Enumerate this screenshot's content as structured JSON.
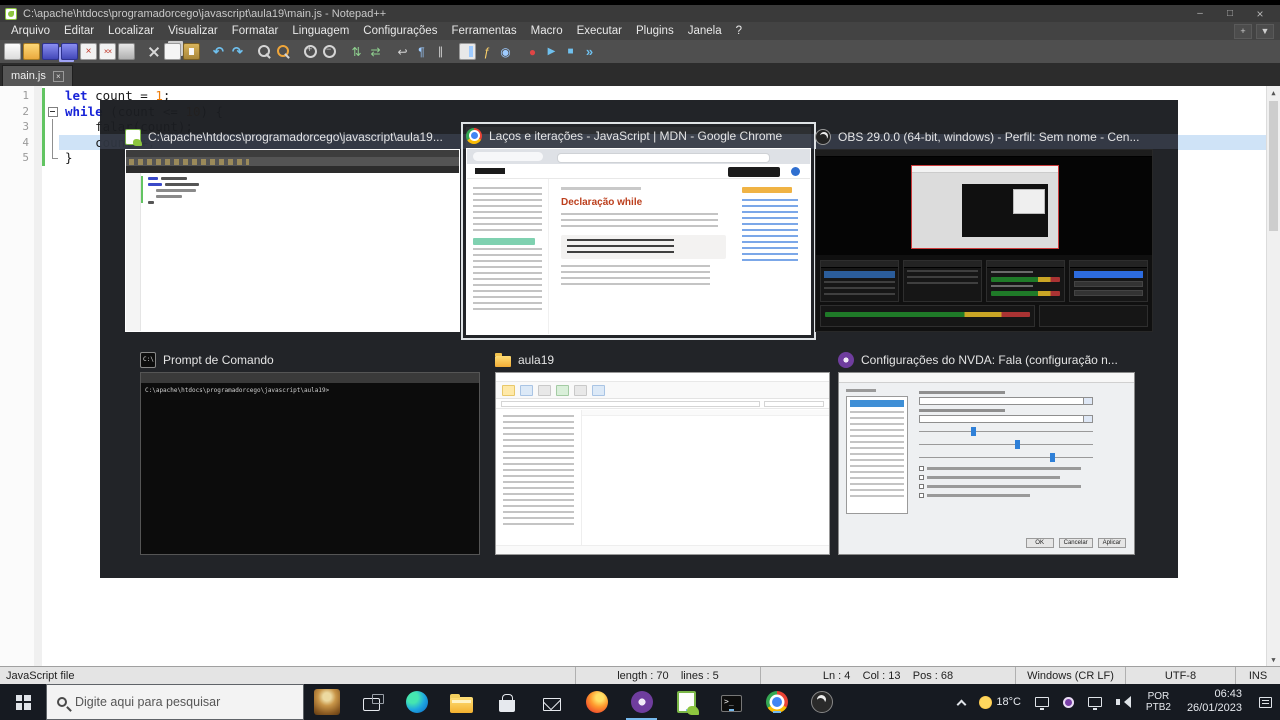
{
  "window": {
    "title": "C:\\apache\\htdocs\\programadorcego\\javascript\\aula19\\main.js - Notepad++"
  },
  "menu": {
    "items": [
      "Arquivo",
      "Editar",
      "Localizar",
      "Visualizar",
      "Formatar",
      "Linguagem",
      "Configurações",
      "Ferramentas",
      "Macro",
      "Executar",
      "Plugins",
      "Janela",
      "?"
    ],
    "plus_button": "+",
    "nav_button": "▼"
  },
  "toolbar": {
    "icons": [
      "new-file",
      "open-folder",
      "save",
      "save-all",
      "close-doc",
      "close-all",
      "print",
      "cut",
      "copy",
      "paste",
      "undo",
      "redo",
      "find",
      "replace",
      "zoom-in",
      "zoom-out",
      "sync-v",
      "sync-h",
      "word-wrap",
      "show-symbols",
      "indent-guide",
      "doc-map",
      "function-list",
      "monitor",
      "record-macro",
      "play-macro",
      "stop-macro",
      "multi-play"
    ]
  },
  "tabs": {
    "active": "main.js"
  },
  "editor": {
    "lines": {
      "l1": {
        "n": "1",
        "kw": "let",
        "mid": " count = ",
        "num": "1",
        "end": ";"
      },
      "l2": {
        "n": "2",
        "kw": "while",
        "mid": " (count <= ",
        "num": "10",
        "end": ") {"
      },
      "l3": {
        "n": "3",
        "code": "    falar(count);"
      },
      "l4": {
        "n": "4",
        "code": "    count++;"
      },
      "l5": {
        "n": "5",
        "code": "}"
      }
    }
  },
  "statusbar": {
    "doctype": "JavaScript file",
    "length": "length : 70    lines : 5",
    "position": "Ln : 4    Col : 13    Pos : 68",
    "eol": "Windows (CR LF)",
    "encoding": "UTF-8",
    "mode": "INS"
  },
  "alttab": {
    "windows": [
      {
        "title": "C:\\apache\\htdocs\\programadorcego\\javascript\\aula19..."
      },
      {
        "title": "Laços e iterações - JavaScript | MDN - Google Chrome"
      },
      {
        "title": "OBS 29.0.0 (64-bit, windows) - Perfil: Sem nome - Cen..."
      },
      {
        "title": "Prompt de Comando"
      },
      {
        "title": "aula19"
      },
      {
        "title": "Configurações do NVDA: Fala (configuração n..."
      }
    ],
    "mdn_heading": "Declaração while",
    "cmd_prompt": "C:\\apache\\htdocs\\programadorcego\\javascript\\aula19>",
    "nvda_ok": "OK",
    "nvda_cancel": "Cancelar",
    "nvda_apply": "Aplicar"
  },
  "taskbar": {
    "search_placeholder": "Digite aqui para pesquisar",
    "icons": [
      {
        "name": "pinned-app",
        "open": false
      },
      {
        "name": "task-view",
        "open": false
      },
      {
        "name": "edge",
        "open": false
      },
      {
        "name": "file-explorer",
        "open": true
      },
      {
        "name": "store",
        "open": false
      },
      {
        "name": "mail",
        "open": false
      },
      {
        "name": "firefox",
        "open": false
      },
      {
        "name": "nvda",
        "open": true
      },
      {
        "name": "notepadpp",
        "open": true
      },
      {
        "name": "terminal",
        "open": true
      },
      {
        "name": "chrome",
        "open": true
      },
      {
        "name": "obs",
        "open": true
      }
    ],
    "tray": {
      "temperature": "18°C",
      "lang1": "POR",
      "lang2": "PTB2",
      "time": "06:43",
      "date": "26/01/2023"
    }
  },
  "colors": {
    "accent": "#76b9ed",
    "selection_border": "#dfe3e6",
    "keyword": "#1824d8",
    "number_literal": "#ef7d0a",
    "caret_line": "#cfe3f7",
    "change_history": "#62c462"
  }
}
